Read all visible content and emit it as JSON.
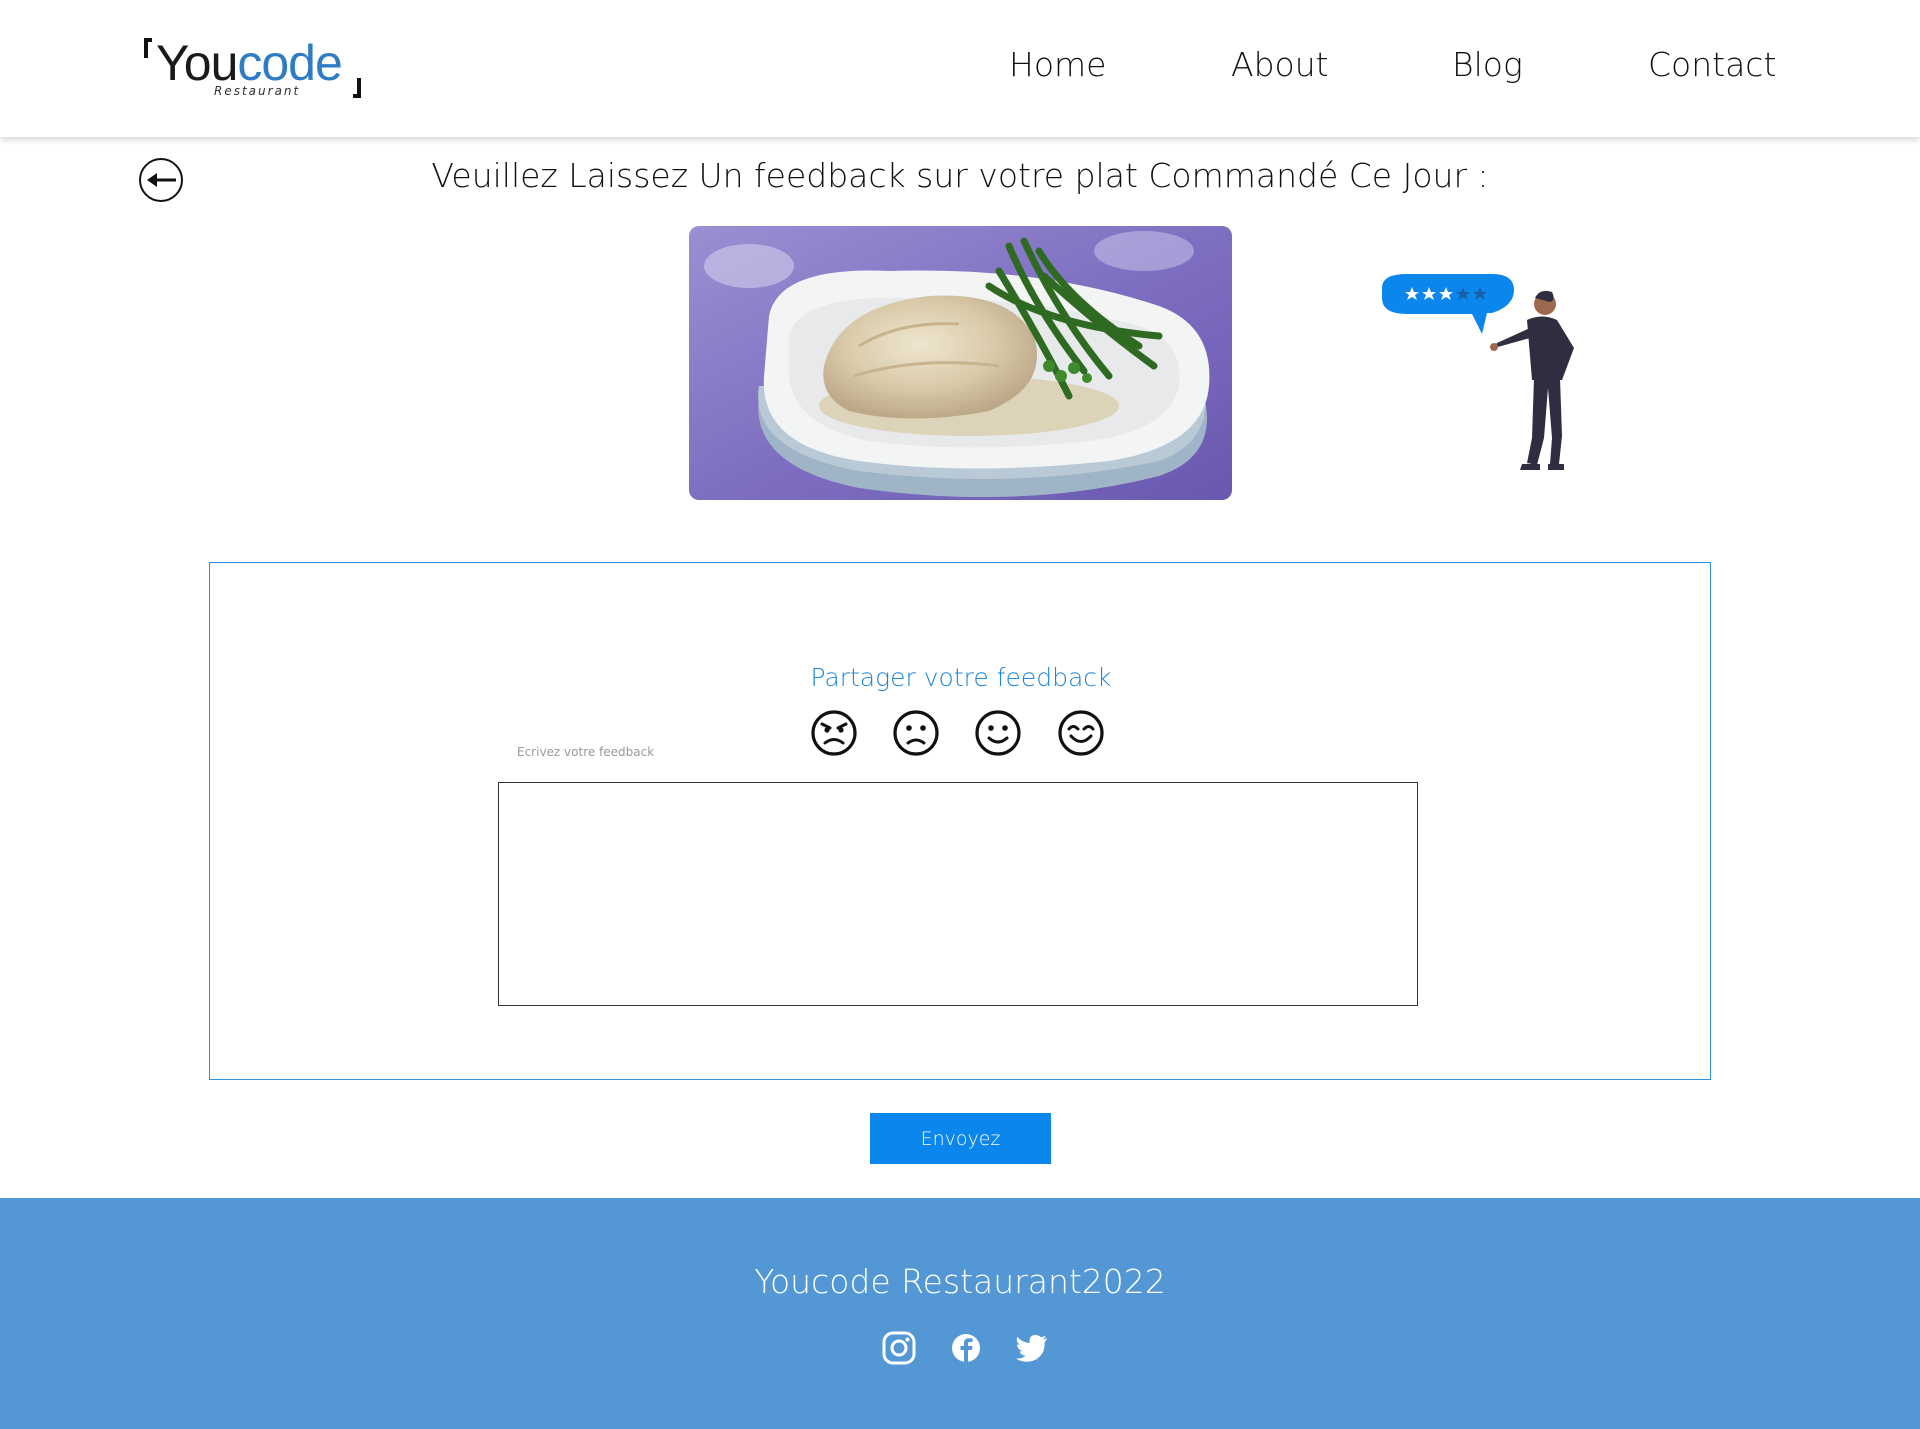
{
  "header": {
    "logo": {
      "primary": "You",
      "accent": "code",
      "sub": "Restaurant"
    },
    "nav": [
      "Home",
      "About",
      "Blog",
      "Contact"
    ]
  },
  "main": {
    "title": "Veuillez Laissez Un feedback sur votre plat Commandé Ce Jour :",
    "back_icon": "arrow-left-icon",
    "dish_image": "plated-fish-with-green-beans",
    "illustration": "person-with-rating-speech-bubble",
    "illustration_rating": {
      "filled": 3,
      "total": 5
    }
  },
  "feedback": {
    "title": "Partager votre feedback",
    "emojis": [
      "angry-face-icon",
      "sad-face-icon",
      "smile-face-icon",
      "happy-face-icon"
    ],
    "label": "Ecrivez votre feedback",
    "text_value": "",
    "submit_label": "Envoyez"
  },
  "footer": {
    "title": "Youcode Restaurant2022",
    "social": [
      "instagram-icon",
      "facebook-icon",
      "twitter-icon"
    ]
  },
  "colors": {
    "accent": "#0a86ec",
    "panel_border": "#2d8fe0",
    "footer_bg": "#5398d4",
    "logo_accent": "#2e7cc4"
  }
}
